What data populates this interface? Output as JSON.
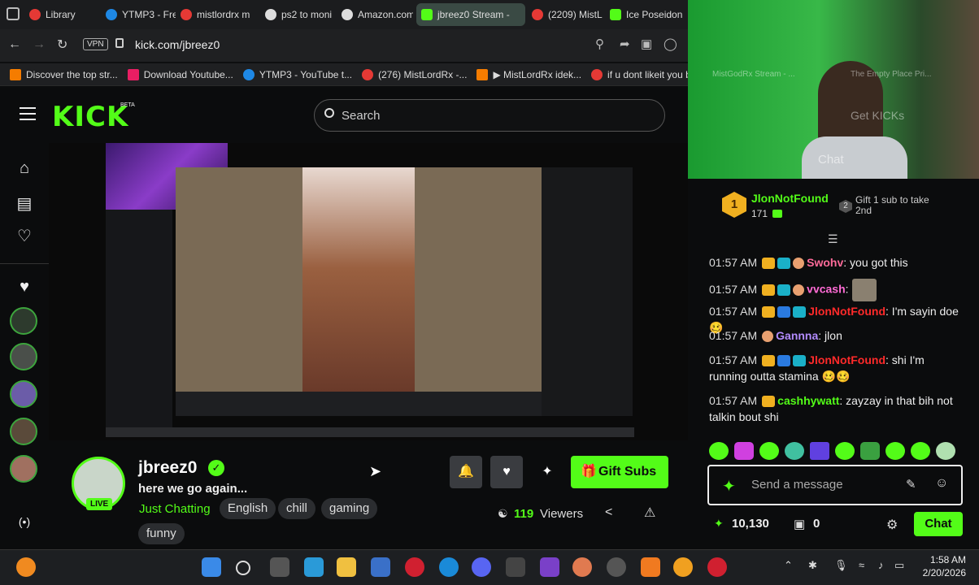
{
  "browser": {
    "tabs": [
      {
        "label": "Library",
        "color": "#e53935"
      },
      {
        "label": "YTMP3 - Fre",
        "color": "#1e88e5"
      },
      {
        "label": "mistlordrx m",
        "color": "#e53935"
      },
      {
        "label": "ps2 to moni",
        "color": "#dddddd"
      },
      {
        "label": "Amazon.com",
        "color": "#dddddd"
      },
      {
        "label": "jbreez0 Stream -",
        "color": "#53fc18"
      },
      {
        "label": "(2209) MistL",
        "color": "#e53935"
      },
      {
        "label": "Ice Poseidon",
        "color": "#53fc18"
      }
    ],
    "vpn_label": "VPN",
    "url": "kick.com/jbreez0",
    "bookmarks": [
      {
        "label": "Discover the top str...",
        "color": "#f57c00"
      },
      {
        "label": "Download Youtube...",
        "color": "#e91e63"
      },
      {
        "label": "YTMP3 - YouTube t...",
        "color": "#1e88e5"
      },
      {
        "label": "(276) MistLordRx -...",
        "color": "#e53935"
      },
      {
        "label": "▶ MistLordRx idek...",
        "color": "#f57c00"
      },
      {
        "label": "if u dont likeit you b...",
        "color": "#e53935"
      }
    ]
  },
  "kick": {
    "logo": "KICK",
    "logo_badge": "BETA",
    "search_placeholder": "Search",
    "accent": "#53fc18"
  },
  "streamer": {
    "name": "jbreez0",
    "title": "here we go again...",
    "category": "Just Chatting",
    "tags": [
      "English",
      "chill",
      "gaming",
      "funny"
    ],
    "live_label": "LIVE",
    "viewers_count": "119",
    "viewers_label": "Viewers",
    "gift_label": "Gift Subs"
  },
  "chat": {
    "top_gifter": {
      "rank": "1",
      "name": "JlonNotFound",
      "count": "171"
    },
    "gift_prompt_rank": "2",
    "gift_prompt": "Gift 1 sub to take 2nd",
    "messages": [
      {
        "time": "01:57 AM",
        "user": "Swohv",
        "color": "#ff6b9a",
        "text": ": you got this"
      },
      {
        "time": "01:57 AM",
        "user": "vvcash",
        "color": "#ff6bd5",
        "text": ":"
      },
      {
        "time": "01:57 AM",
        "user": "JlonNotFound",
        "color": "#ff2a2a",
        "text": ": I'm sayin doe🥴"
      },
      {
        "time": "01:57 AM",
        "user": "Gannna",
        "color": "#b38cff",
        "text": ": jlon"
      },
      {
        "time": "01:57 AM",
        "user": "JlonNotFound",
        "color": "#ff2a2a",
        "text": ": shi I'm running outta stamina 🥴🥴"
      },
      {
        "time": "01:57 AM",
        "user": "cashhywatt",
        "color": "#53fc18",
        "text": ": zayzay in that bih not talkin bout shi"
      }
    ],
    "input_placeholder": "Send a message",
    "points": "10,130",
    "gifts_count": "0",
    "chat_button": "Chat"
  },
  "cam_overlay": {
    "tab_label": "MistGodRx Stream - ...",
    "tab2_label": "The Empty Place Pri...",
    "get_kicks": "Get KICKs",
    "chat_label": "Chat"
  },
  "taskbar": {
    "time": "1:58 AM",
    "date": "2/20/2026"
  },
  "colors": {
    "kick_green": "#53fc18",
    "background": "#0b0c0d",
    "cam_green": "#1c8a2c"
  }
}
